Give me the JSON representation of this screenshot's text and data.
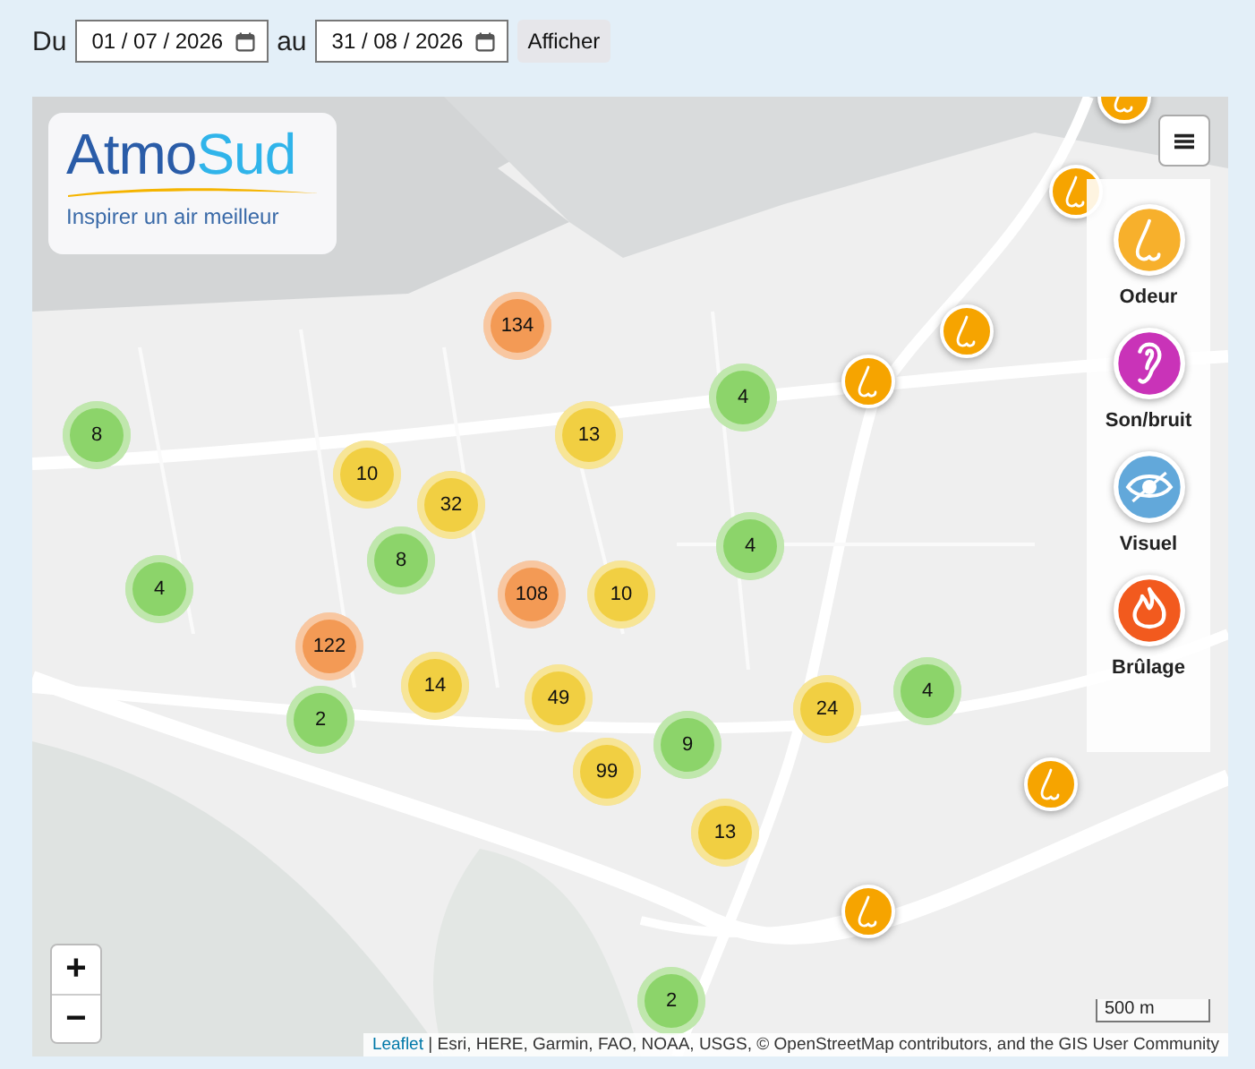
{
  "filter": {
    "from_label": "Du",
    "from_date": "01 / 07 / 2026",
    "to_label": "au",
    "to_date": "31 / 08 / 2026",
    "submit": "Afficher"
  },
  "logo": {
    "first": "Atmo",
    "second": "Sud",
    "tagline": "Inspirer un air meilleur"
  },
  "clusters": [
    {
      "count": "134",
      "color": "#f39a55"
    },
    {
      "count": "13",
      "color": "#f1cf42"
    },
    {
      "count": "4",
      "color": "#8cd46a"
    },
    {
      "count": "8",
      "color": "#8cd46a"
    },
    {
      "count": "10",
      "color": "#f1cf42"
    },
    {
      "count": "32",
      "color": "#f1cf42"
    },
    {
      "count": "8",
      "color": "#8cd46a"
    },
    {
      "count": "4",
      "color": "#8cd46a"
    },
    {
      "count": "4",
      "color": "#8cd46a"
    },
    {
      "count": "108",
      "color": "#f39a55"
    },
    {
      "count": "10",
      "color": "#f1cf42"
    },
    {
      "count": "122",
      "color": "#f39a55"
    },
    {
      "count": "14",
      "color": "#f1cf42"
    },
    {
      "count": "49",
      "color": "#f1cf42"
    },
    {
      "count": "24",
      "color": "#f1cf42"
    },
    {
      "count": "4",
      "color": "#8cd46a"
    },
    {
      "count": "2",
      "color": "#8cd46a"
    },
    {
      "count": "9",
      "color": "#8cd46a"
    },
    {
      "count": "99",
      "color": "#f1cf42"
    },
    {
      "count": "13",
      "color": "#f1cf42"
    },
    {
      "count": "2",
      "color": "#8cd46a"
    }
  ],
  "pins": [
    {
      "kind": "nose",
      "color": "#f6a400"
    },
    {
      "kind": "nose",
      "color": "#f6a400"
    },
    {
      "kind": "nose",
      "color": "#f6a400"
    },
    {
      "kind": "nose",
      "color": "#f6a400"
    },
    {
      "kind": "nose",
      "color": "#f6a400"
    },
    {
      "kind": "nose",
      "color": "#f6a400"
    }
  ],
  "legend": [
    {
      "label": "Odeur",
      "kind": "nose",
      "color": "#f7b02c"
    },
    {
      "label": "Son/bruit",
      "kind": "ear",
      "color": "#c933b8"
    },
    {
      "label": "Visuel",
      "kind": "eye",
      "color": "#62a8da"
    },
    {
      "label": "Brûlage",
      "kind": "fire",
      "color": "#f25a1e"
    }
  ],
  "zoom": {
    "in": "+",
    "out": "−"
  },
  "scale": "500 m",
  "attribution": {
    "link": "Leaflet",
    "text": " | Esri, HERE, Garmin, FAO, NOAA, USGS, © OpenStreetMap contributors, and the GIS User Community"
  }
}
